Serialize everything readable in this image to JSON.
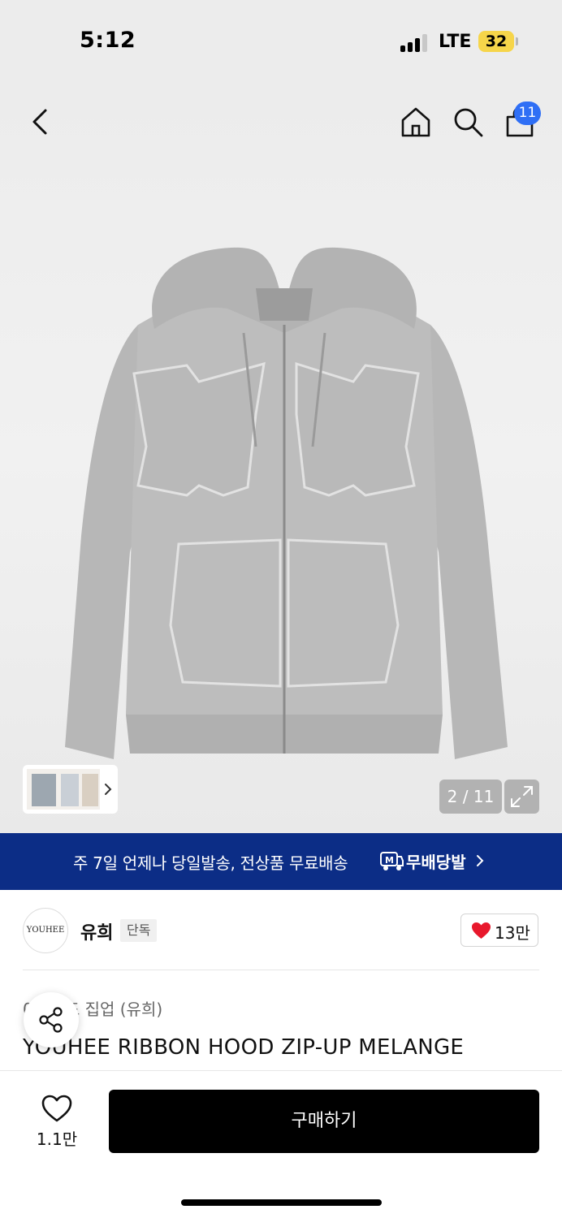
{
  "status_bar": {
    "time": "5:12",
    "network": "LTE",
    "battery": "32"
  },
  "nav": {
    "back_icon": "chevron-left-icon",
    "home_icon": "home-icon",
    "search_icon": "search-icon",
    "bag_icon": "shopping-bag-icon",
    "bag_count": "11"
  },
  "gallery": {
    "counter": "2 / 11",
    "expand_icon": "expand-icon",
    "thumb_arrow_icon": "chevron-right-icon"
  },
  "promo": {
    "text": "주 7일 언제나 당일발송, 전상품 무료배송",
    "brand": "무배당발",
    "logo_icon": "truck-icon"
  },
  "brand": {
    "logo_text": "YOUHEE",
    "name": "유희",
    "tag": "단독",
    "likes": "13만"
  },
  "product": {
    "breadcrumb": "0  ›  후드 집업 (유희)",
    "title": "YOUHEE RIBBON HOOD ZIP-UP MELANGE"
  },
  "bottom": {
    "wish_count": "1.1만",
    "buy_label": "구매하기"
  },
  "colors": {
    "promo_bg": "#0c2d86",
    "badge": "#2f6ff5",
    "heart": "#e8182c"
  }
}
